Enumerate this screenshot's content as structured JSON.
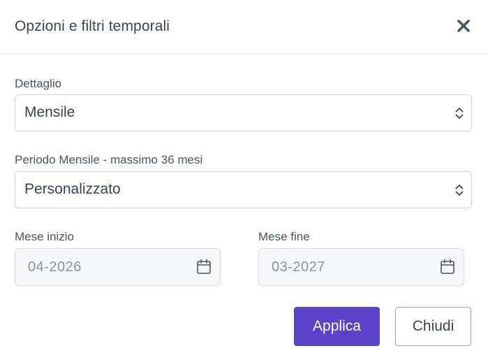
{
  "dialog": {
    "title": "Opzioni e filtri temporali",
    "close_icon": "close-icon"
  },
  "dettaglio": {
    "label": "Dettaglio",
    "value": "Mensile"
  },
  "periodo": {
    "label": "Periodo Mensile - massimo 36 mesi",
    "value": "Personalizzato"
  },
  "mese_inizio": {
    "label": "Mese inizio",
    "value": "04-2026",
    "icon": "calendar-icon"
  },
  "mese_fine": {
    "label": "Mese fine",
    "value": "03-2027",
    "icon": "calendar-icon"
  },
  "buttons": {
    "apply": "Applica",
    "close": "Chiudi"
  },
  "colors": {
    "primary": "#5b43c9",
    "text": "#3a4450",
    "disabled_bg": "#f6f7f8",
    "border": "#cfd4da"
  }
}
